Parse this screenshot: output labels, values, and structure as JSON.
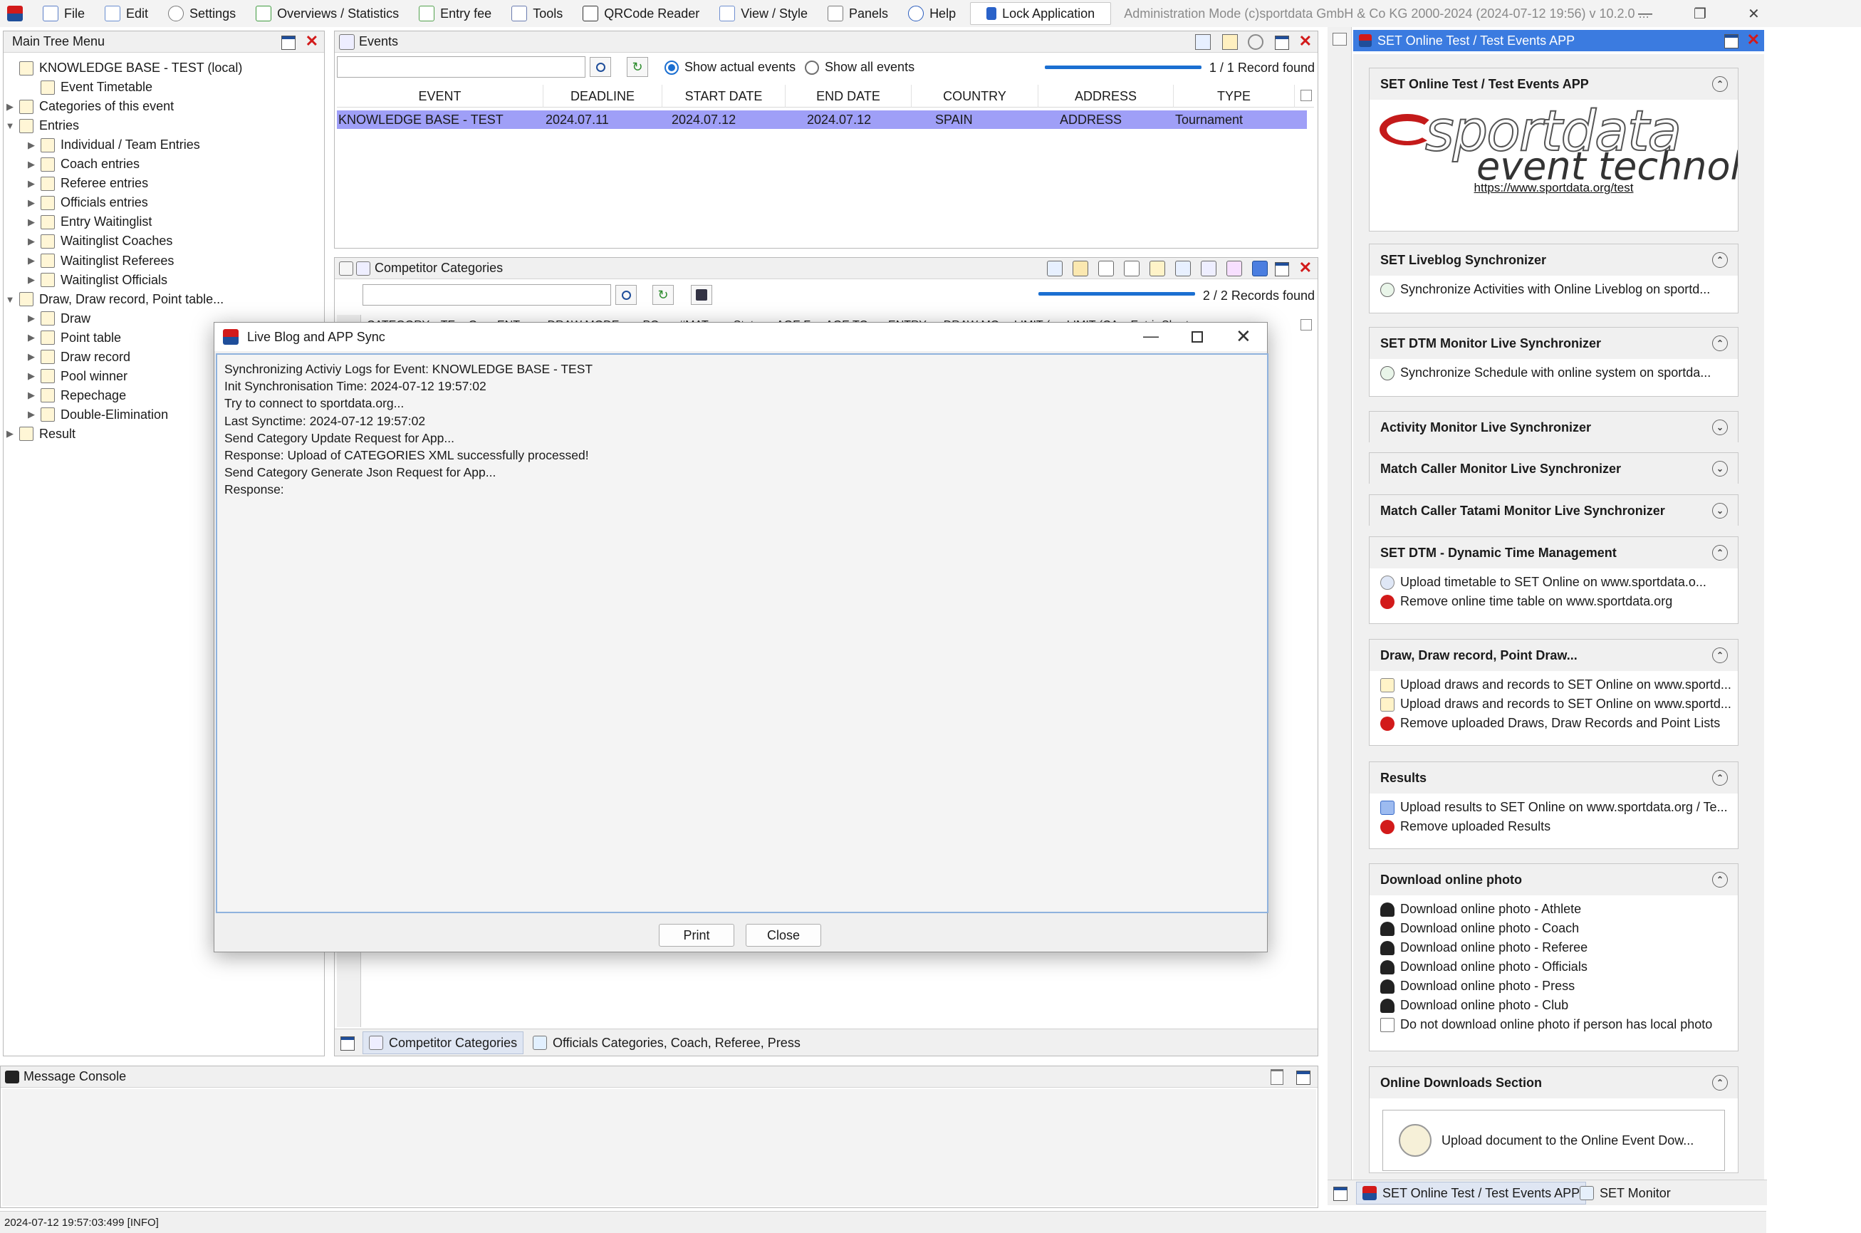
{
  "menu": {
    "items": [
      {
        "label": "File",
        "icon": "file-icon"
      },
      {
        "label": "Edit",
        "icon": "edit-icon"
      },
      {
        "label": "Settings",
        "icon": "gear-icon"
      },
      {
        "label": "Overviews / Statistics",
        "icon": "statistics-icon"
      },
      {
        "label": "Entry fee",
        "icon": "money-icon"
      },
      {
        "label": "Tools",
        "icon": "wrench-icon"
      },
      {
        "label": "QRCode Reader",
        "icon": "qrcode-icon"
      },
      {
        "label": "View / Style",
        "icon": "view-icon"
      },
      {
        "label": "Panels",
        "icon": "panels-icon"
      },
      {
        "label": "Help",
        "icon": "help-icon"
      }
    ],
    "lock_label": "Lock Application",
    "title": "Administration Mode (c)sportdata GmbH & Co KG 2000-2024 (2024-07-12 19:56)  v 10.2.0 ..."
  },
  "tree": {
    "title": "Main Tree Menu",
    "items": [
      {
        "label": "KNOWLEDGE BASE - TEST (local)",
        "level": 0,
        "toggle": ""
      },
      {
        "label": "Event Timetable",
        "level": 1,
        "toggle": ""
      },
      {
        "label": "Categories of this event",
        "level": 0,
        "toggle": "▶"
      },
      {
        "label": "Entries",
        "level": 0,
        "toggle": "▼"
      },
      {
        "label": "Individual / Team Entries",
        "level": 1,
        "toggle": "▶"
      },
      {
        "label": "Coach entries",
        "level": 1,
        "toggle": "▶"
      },
      {
        "label": "Referee entries",
        "level": 1,
        "toggle": "▶"
      },
      {
        "label": "Officials entries",
        "level": 1,
        "toggle": "▶"
      },
      {
        "label": "Entry Waitinglist",
        "level": 1,
        "toggle": "▶"
      },
      {
        "label": "Waitinglist Coaches",
        "level": 1,
        "toggle": "▶"
      },
      {
        "label": "Waitinglist Referees",
        "level": 1,
        "toggle": "▶"
      },
      {
        "label": "Waitinglist Officials",
        "level": 1,
        "toggle": "▶"
      },
      {
        "label": "Draw, Draw record, Point table...",
        "level": 0,
        "toggle": "▼"
      },
      {
        "label": "Draw",
        "level": 1,
        "toggle": "▶"
      },
      {
        "label": "Point table",
        "level": 1,
        "toggle": "▶"
      },
      {
        "label": "Draw record",
        "level": 1,
        "toggle": "▶"
      },
      {
        "label": "Pool winner",
        "level": 1,
        "toggle": "▶"
      },
      {
        "label": "Repechage",
        "level": 1,
        "toggle": "▶"
      },
      {
        "label": "Double-Elimination",
        "level": 1,
        "toggle": "▶"
      },
      {
        "label": "Result",
        "level": 0,
        "toggle": "▶"
      }
    ]
  },
  "events": {
    "title": "Events",
    "radio_actual": "Show actual events",
    "radio_all": "Show all events",
    "record_count": "1 / 1 Record found",
    "columns": [
      "EVENT",
      "DEADLINE",
      "START DATE",
      "END DATE",
      "COUNTRY",
      "ADDRESS",
      "TYPE"
    ],
    "rows": [
      [
        "KNOWLEDGE BASE - TEST",
        "2024.07.11",
        "2024.07.12",
        "2024.07.12",
        "SPAIN",
        "ADDRESS",
        "Tournament"
      ]
    ]
  },
  "categories": {
    "title": "Competitor Categories",
    "record_count": "2 / 2 Records found",
    "columns": [
      "CATEGORY",
      "TE",
      "G",
      "ENT",
      "DRAW MODE",
      "PO",
      "#MAT",
      "Stat",
      "AGE F",
      "AGE TO",
      "ENTRY",
      "DRAW MO",
      "LIMIT (",
      "LIMIT (CA",
      "Entri",
      "Short ..."
    ],
    "tabs": [
      "Competitor Categories",
      "Officials Categories, Coach, Referee, Press"
    ]
  },
  "dialog": {
    "title": "Live Blog and APP Sync",
    "lines": [
      "Synchronizing Activiy Logs for Event: KNOWLEDGE BASE - TEST",
      "Init Synchronisation Time: 2024-07-12 19:57:02",
      "Try to connect to sportdata.org...",
      "Last Synctime: 2024-07-12 19:57:02",
      "Send Category Update Request for App...",
      "Response: Upload of CATEGORIES XML successfully processed!",
      "Send Category Generate Json Request for App...",
      "Response:"
    ],
    "print_label": "Print",
    "close_label": "Close"
  },
  "console": {
    "title": "Message Console"
  },
  "status_text": "2024-07-12 19:57:03:499 [INFO]",
  "right": {
    "title": "SET Online Test / Test Events APP",
    "logo_text_1": "sportdata",
    "logo_text_2": "event technology",
    "logo_link": "https://www.sportdata.org/test",
    "sections": [
      {
        "title": "SET Online Test / Test Events APP",
        "expanded": true,
        "rows": []
      },
      {
        "title": "SET Liveblog Synchronizer",
        "expanded": true,
        "rows": [
          {
            "icon": "sync-icon",
            "text": "Synchronize Activities with Online Liveblog on sportd..."
          }
        ]
      },
      {
        "title": "SET DTM Monitor Live Synchronizer",
        "expanded": true,
        "rows": [
          {
            "icon": "sync-icon",
            "text": "Synchronize Schedule with online system on sportda..."
          }
        ]
      },
      {
        "title": "Activity Monitor Live Synchronizer",
        "expanded": false,
        "rows": []
      },
      {
        "title": "Match Caller Monitor Live Synchronizer",
        "expanded": false,
        "rows": []
      },
      {
        "title": "Match Caller Tatami Monitor Live Synchronizer",
        "expanded": false,
        "rows": []
      },
      {
        "title": "SET DTM - Dynamic Time Management",
        "expanded": true,
        "rows": [
          {
            "icon": "upload-icon",
            "text": "Upload timetable to SET Online on www.sportdata.o..."
          },
          {
            "icon": "remove-icon",
            "text": "Remove online time table on www.sportdata.org"
          }
        ]
      },
      {
        "title": "Draw, Draw record, Point Draw...",
        "expanded": true,
        "rows": [
          {
            "icon": "draw-upload-icon",
            "text": "Upload draws and records to SET Online on www.sportd..."
          },
          {
            "icon": "draw-upload-icon",
            "text": "Upload draws and records to SET Online on www.sportd..."
          },
          {
            "icon": "remove-icon",
            "text": "Remove uploaded Draws, Draw Records and Point Lists"
          }
        ]
      },
      {
        "title": "Results",
        "expanded": true,
        "rows": [
          {
            "icon": "results-icon",
            "text": "Upload results to SET Online on www.sportdata.org / Te..."
          },
          {
            "icon": "remove-icon",
            "text": "Remove uploaded Results"
          }
        ]
      },
      {
        "title": "Download online photo",
        "expanded": true,
        "rows": [
          {
            "icon": "person-icon",
            "text": "Download online photo - Athlete"
          },
          {
            "icon": "person-icon",
            "text": "Download online photo - Coach"
          },
          {
            "icon": "person-icon",
            "text": "Download online photo - Referee"
          },
          {
            "icon": "person-icon",
            "text": "Download online photo - Officials"
          },
          {
            "icon": "person-icon",
            "text": "Download online photo - Press"
          },
          {
            "icon": "person-icon",
            "text": "Download online photo - Club"
          },
          {
            "icon": "checkbox-icon",
            "text": "Do not download online photo if person has local photo"
          }
        ]
      },
      {
        "title": "Online Downloads Section",
        "expanded": true,
        "rows": []
      }
    ],
    "upload_doc_label": "Upload document to the Online Event Dow...",
    "tabs": [
      "SET Online Test / Test Events APP",
      "SET Monitor"
    ]
  },
  "colors": {
    "selection": "#9f9ff7",
    "accent": "#1b6fd1",
    "brand_red": "#d21a1a",
    "logo_red": "#c41a1a"
  }
}
